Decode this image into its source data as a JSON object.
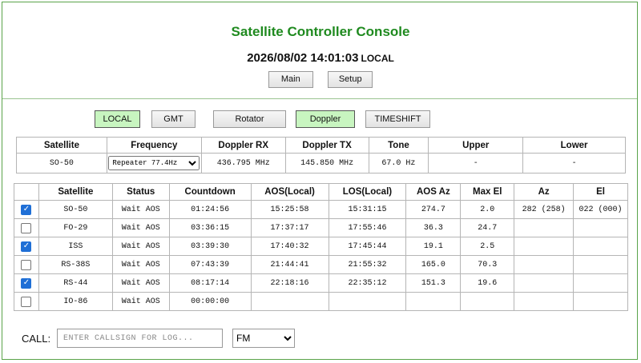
{
  "app": {
    "title": "Satellite Controller Console",
    "datetime": "2026/08/02 14:01:03",
    "timezone_label": "LOCAL"
  },
  "nav": {
    "main_label": "Main",
    "setup_label": "Setup"
  },
  "modes": {
    "local": "LOCAL",
    "gmt": "GMT",
    "rotator": "Rotator",
    "doppler": "Doppler",
    "timeshift": "TIMESHIFT",
    "active": [
      "LOCAL",
      "Doppler"
    ]
  },
  "doppler_table": {
    "headers": [
      "Satellite",
      "Frequency",
      "Doppler RX",
      "Doppler TX",
      "Tone",
      "Upper",
      "Lower"
    ],
    "row": {
      "satellite": "SO-50",
      "frequency_selected": "Repeater 77.4Hz",
      "doppler_rx": "436.795 MHz",
      "doppler_tx": "145.850 MHz",
      "tone": "67.0 Hz",
      "upper": "-",
      "lower": "-"
    }
  },
  "pass_table": {
    "headers": [
      "",
      "Satellite",
      "Status",
      "Countdown",
      "AOS(Local)",
      "LOS(Local)",
      "AOS Az",
      "Max El",
      "Az",
      "El"
    ],
    "rows": [
      {
        "checked": true,
        "satellite": "SO-50",
        "status": "Wait AOS",
        "countdown": "01:24:56",
        "aos": "15:25:58",
        "los": "15:31:15",
        "aos_az": "274.7",
        "max_el": "2.0",
        "az": "282 (258)",
        "el": "022 (000)"
      },
      {
        "checked": false,
        "satellite": "FO-29",
        "status": "Wait AOS",
        "countdown": "03:36:15",
        "aos": "17:37:17",
        "los": "17:55:46",
        "aos_az": "36.3",
        "max_el": "24.7",
        "az": "",
        "el": ""
      },
      {
        "checked": true,
        "satellite": "ISS",
        "status": "Wait AOS",
        "countdown": "03:39:30",
        "aos": "17:40:32",
        "los": "17:45:44",
        "aos_az": "19.1",
        "max_el": "2.5",
        "az": "",
        "el": ""
      },
      {
        "checked": false,
        "satellite": "RS-38S",
        "status": "Wait AOS",
        "countdown": "07:43:39",
        "aos": "21:44:41",
        "los": "21:55:32",
        "aos_az": "165.0",
        "max_el": "70.3",
        "az": "",
        "el": ""
      },
      {
        "checked": true,
        "satellite": "RS-44",
        "status": "Wait AOS",
        "countdown": "08:17:14",
        "aos": "22:18:16",
        "los": "22:35:12",
        "aos_az": "151.3",
        "max_el": "19.6",
        "az": "",
        "el": ""
      },
      {
        "checked": false,
        "satellite": "IO-86",
        "status": "Wait AOS",
        "countdown": "00:00:00",
        "aos": "",
        "los": "",
        "aos_az": "",
        "max_el": "",
        "az": "",
        "el": ""
      }
    ]
  },
  "call": {
    "label": "CALL:",
    "placeholder": "ENTER CALLSIGN FOR LOG...",
    "mode_selected": "FM"
  },
  "colors": {
    "title_green": "#1f8a1f",
    "active_button": "#c8f5c0",
    "frame_border": "#5aa34a",
    "checkbox_blue": "#1f6fd6"
  }
}
